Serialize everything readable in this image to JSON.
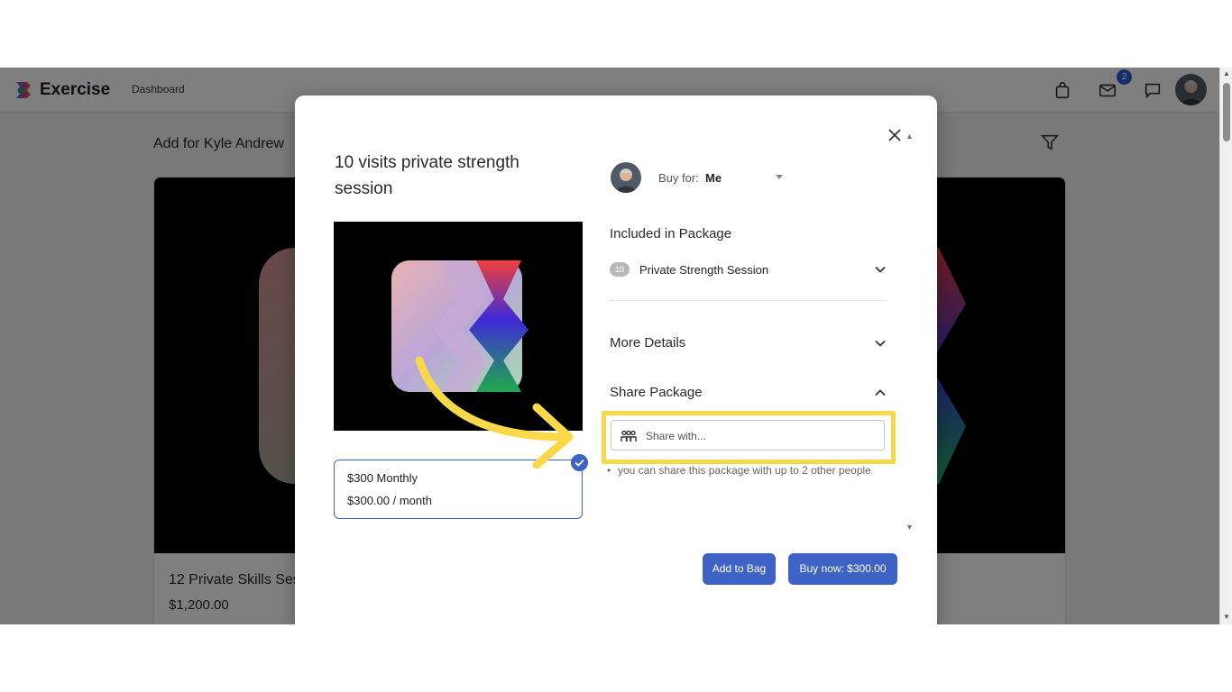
{
  "header": {
    "app_title": "Exercise",
    "nav_dashboard": "Dashboard",
    "mail_badge_count": "2",
    "icons": [
      "logo-icon",
      "shopping-bag-icon",
      "mail-icon",
      "chat-icon",
      "avatar"
    ]
  },
  "page": {
    "heading": "Add for Kyle Andrew",
    "card": {
      "title": "12 Private Skills Ses",
      "price": "$1,200.00"
    }
  },
  "modal": {
    "title": "10 visits private strength session",
    "plan": {
      "name": "$300 Monthly",
      "rate": "$300.00 / month"
    },
    "buy_for": {
      "label": "Buy for:",
      "value": "Me"
    },
    "included": {
      "heading": "Included in Package",
      "count": "10",
      "session_name": "Private Strength Session"
    },
    "more_details": "More Details",
    "share": {
      "heading": "Share Package",
      "placeholder": "Share with...",
      "hint": "you can share this package with up to 2 other people"
    },
    "buttons": {
      "add_to_bag": "Add to Bag",
      "buy_now": "Buy now: $300.00"
    }
  },
  "colors": {
    "accent": "#3f62c7",
    "highlight": "#f9d84a"
  }
}
